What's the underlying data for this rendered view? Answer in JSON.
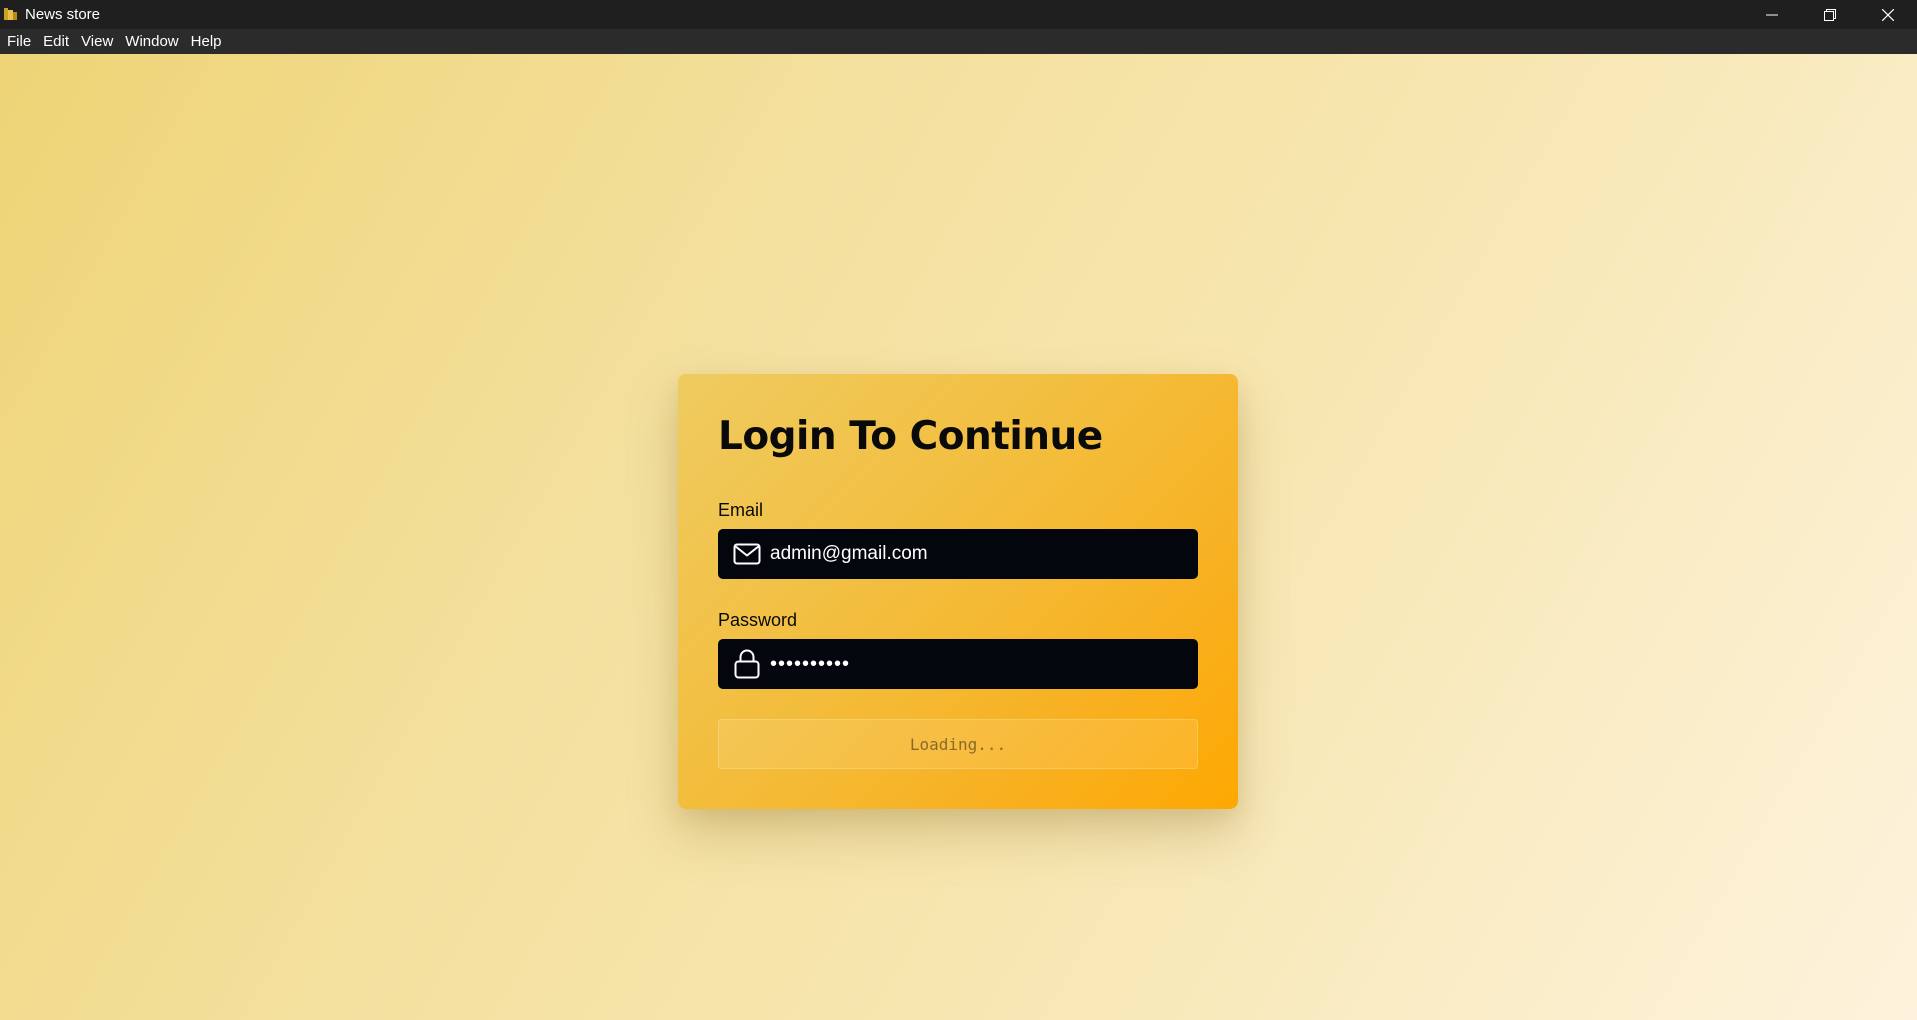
{
  "window": {
    "title": "News store",
    "controls": [
      "minimize",
      "restore",
      "close"
    ]
  },
  "menu": {
    "items": [
      "File",
      "Edit",
      "View",
      "Window",
      "Help"
    ]
  },
  "login": {
    "title": "Login To Continue",
    "email_label": "Email",
    "email_value": "admin@gmail.com",
    "password_label": "Password",
    "password_value": "••••••••••",
    "submit_label": "Loading..."
  },
  "colors": {
    "card_gradient_start": "#efcb60",
    "card_gradient_end": "#fea802",
    "input_background": "#03060d",
    "titlebar": "#1f1f1f",
    "menubar": "#2b2b2b"
  },
  "icons": {
    "email": "mail-icon",
    "password": "lock-icon"
  }
}
